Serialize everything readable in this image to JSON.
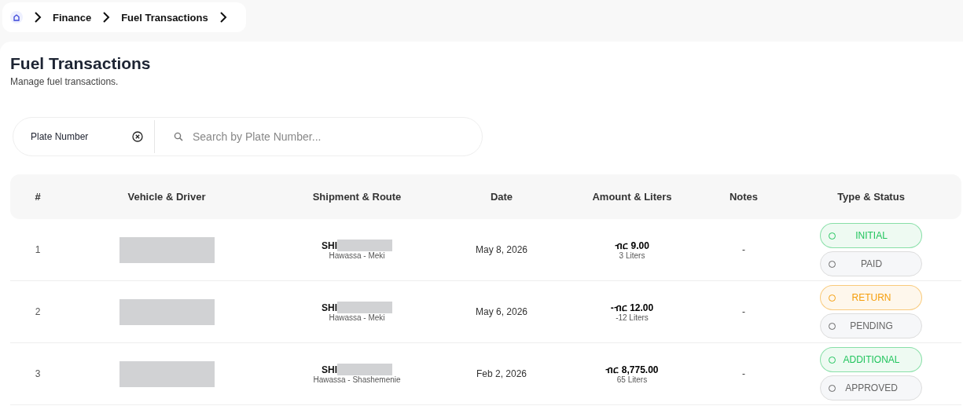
{
  "breadcrumb": [
    "Finance",
    "Fuel Transactions"
  ],
  "page": {
    "title": "Fuel Transactions",
    "subtitle": "Manage fuel transactions."
  },
  "filter": {
    "field_label": "Plate Number",
    "placeholder": "Search by Plate Number..."
  },
  "table": {
    "columns": [
      "#",
      "Vehicle & Driver",
      "Shipment & Route",
      "Date",
      "Amount & Liters",
      "Notes",
      "Type & Status"
    ],
    "rows": [
      {
        "index": "1",
        "shipment": "SHI",
        "route": "Hawassa - Meki",
        "date": "May 8, 2026",
        "amount": "ብር 9.00",
        "liters": "3 Liters",
        "notes": "-",
        "type": {
          "label": "INITIAL",
          "color": "#22c55e"
        },
        "status": "PAID"
      },
      {
        "index": "2",
        "shipment": "SHI",
        "route": "Hawassa - Meki",
        "date": "May 6, 2026",
        "amount": "-ብር 12.00",
        "liters": "-12 Liters",
        "notes": "-",
        "type": {
          "label": "RETURN",
          "color": "#f59e0b"
        },
        "status": "PENDING"
      },
      {
        "index": "3",
        "shipment": "SHI",
        "route": "Hawassa - Shashemenie",
        "date": "Feb 2, 2026",
        "amount": "ብር 8,775.00",
        "liters": "65 Liters",
        "notes": "-",
        "type": {
          "label": "ADDITIONAL",
          "color": "#22c55e"
        },
        "status": "APPROVED"
      }
    ]
  }
}
